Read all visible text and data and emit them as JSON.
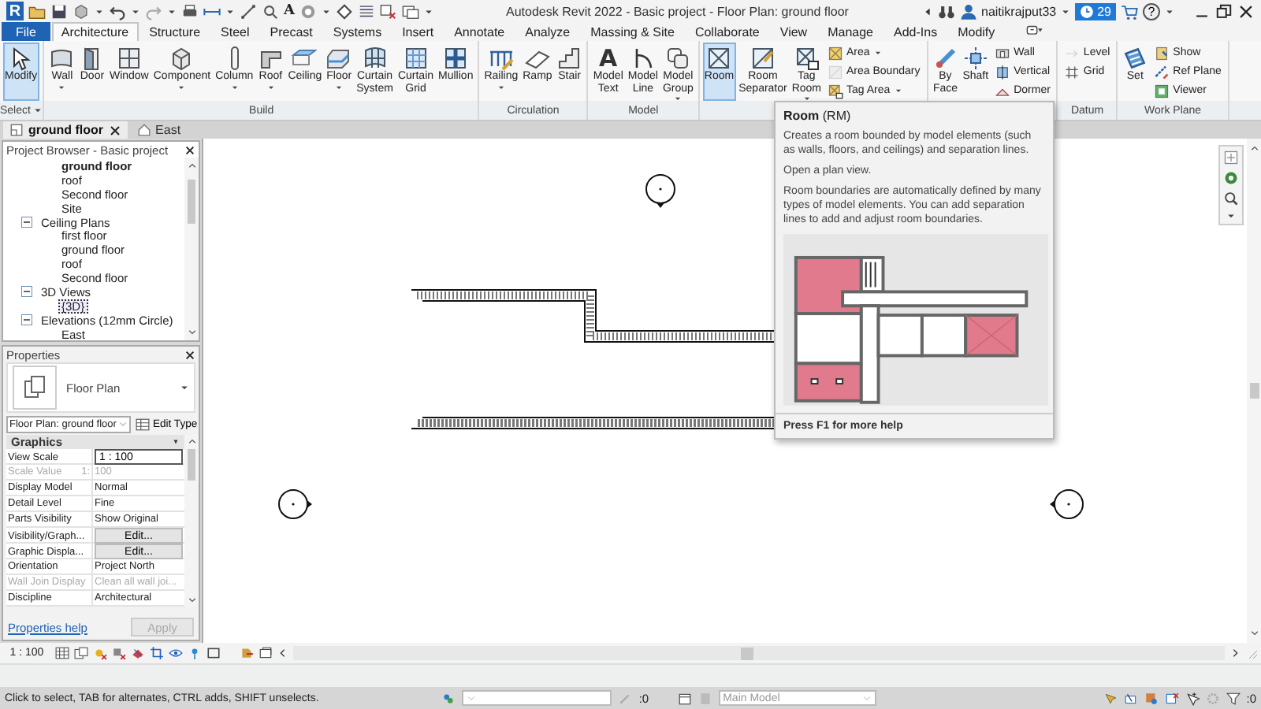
{
  "window": {
    "logo": "R",
    "text_tool": "A",
    "title": "Autodesk Revit 2022 - Basic project - Floor Plan: ground floor",
    "user": "naitikrajput33",
    "notifications": "29",
    "help": "?"
  },
  "ribbon_tabs": [
    {
      "label": "File",
      "kind": "application",
      "selected": false
    },
    {
      "label": "Architecture",
      "kind": "tab",
      "selected": true
    },
    {
      "label": "Structure",
      "kind": "tab",
      "selected": false
    },
    {
      "label": "Steel",
      "kind": "tab",
      "selected": false
    },
    {
      "label": "Precast",
      "kind": "tab",
      "selected": false
    },
    {
      "label": "Systems",
      "kind": "tab",
      "selected": false
    },
    {
      "label": "Insert",
      "kind": "tab",
      "selected": false
    },
    {
      "label": "Annotate",
      "kind": "tab",
      "selected": false
    },
    {
      "label": "Analyze",
      "kind": "tab",
      "selected": false
    },
    {
      "label": "Massing & Site",
      "kind": "tab",
      "selected": false
    },
    {
      "label": "Collaborate",
      "kind": "tab",
      "selected": false
    },
    {
      "label": "View",
      "kind": "tab",
      "selected": false
    },
    {
      "label": "Manage",
      "kind": "tab",
      "selected": false
    },
    {
      "label": "Add-Ins",
      "kind": "tab",
      "selected": false
    },
    {
      "label": "Modify",
      "kind": "tab",
      "selected": false
    }
  ],
  "ribbon_panels": [
    {
      "title": "Select",
      "title_dropdown": true,
      "tools": [
        {
          "label": "Modify",
          "kind": "large",
          "selected": true,
          "disabled": false,
          "dropdown": false
        }
      ]
    },
    {
      "title": "Build",
      "tools": [
        {
          "label": "Wall",
          "kind": "large",
          "selected": false,
          "disabled": false,
          "dropdown": true
        },
        {
          "label": "Door",
          "kind": "large",
          "selected": false,
          "disabled": false,
          "dropdown": false
        },
        {
          "label": "Window",
          "kind": "large",
          "selected": false,
          "disabled": false,
          "dropdown": false
        },
        {
          "label": "Component",
          "kind": "large",
          "selected": false,
          "disabled": false,
          "dropdown": true
        },
        {
          "label": "Column",
          "kind": "large",
          "selected": false,
          "disabled": false,
          "dropdown": true
        },
        {
          "label": "Roof",
          "kind": "large",
          "selected": false,
          "disabled": false,
          "dropdown": true
        },
        {
          "label": "Ceiling",
          "kind": "large",
          "selected": false,
          "disabled": false,
          "dropdown": false
        },
        {
          "label": "Floor",
          "kind": "large",
          "selected": false,
          "disabled": false,
          "dropdown": true
        },
        {
          "label": "Curtain System",
          "kind": "large",
          "selected": false,
          "disabled": false,
          "dropdown": false
        },
        {
          "label": "Curtain Grid",
          "kind": "large",
          "selected": false,
          "disabled": false,
          "dropdown": false
        },
        {
          "label": "Mullion",
          "kind": "large",
          "selected": false,
          "disabled": false,
          "dropdown": false
        }
      ]
    },
    {
      "title": "Circulation",
      "tools": [
        {
          "label": "Railing",
          "kind": "large",
          "selected": false,
          "disabled": false,
          "dropdown": true
        },
        {
          "label": "Ramp",
          "kind": "large",
          "selected": false,
          "disabled": false,
          "dropdown": false
        },
        {
          "label": "Stair",
          "kind": "large",
          "selected": false,
          "disabled": false,
          "dropdown": false
        }
      ]
    },
    {
      "title": "Model",
      "tools": [
        {
          "label": "Model Text",
          "kind": "large",
          "glyph": "A",
          "selected": false,
          "disabled": false,
          "dropdown": false
        },
        {
          "label": "Model Line",
          "kind": "large",
          "selected": false,
          "disabled": false,
          "dropdown": false
        },
        {
          "label": "Model Group",
          "kind": "large",
          "selected": false,
          "disabled": false,
          "dropdown": true
        }
      ]
    },
    {
      "tools": [
        {
          "label": "Room",
          "kind": "large",
          "selected": true,
          "disabled": false,
          "dropdown": false
        },
        {
          "label": "Room Separator",
          "kind": "large",
          "selected": false,
          "disabled": false,
          "dropdown": false
        },
        {
          "label": "Tag Room",
          "kind": "large",
          "selected": false,
          "disabled": false,
          "dropdown": true
        },
        {
          "label": "Area",
          "kind": "small",
          "selected": false,
          "disabled": false,
          "dropdown": true
        },
        {
          "label": "Area Boundary",
          "kind": "small",
          "selected": false,
          "disabled": true,
          "dropdown": false
        },
        {
          "label": "Tag Area",
          "kind": "small",
          "selected": false,
          "disabled": false,
          "dropdown": true
        }
      ]
    },
    {
      "tools": [
        {
          "label": "By Face",
          "kind": "large",
          "selected": false,
          "disabled": false,
          "dropdown": false
        },
        {
          "label": "Shaft",
          "kind": "large",
          "selected": false,
          "disabled": false,
          "dropdown": false
        },
        {
          "label": "Wall",
          "kind": "small",
          "selected": false,
          "disabled": false,
          "dropdown": false
        },
        {
          "label": "Vertical",
          "kind": "small",
          "selected": false,
          "disabled": false,
          "dropdown": false
        },
        {
          "label": "Dormer",
          "kind": "small",
          "selected": false,
          "disabled": false,
          "dropdown": false
        }
      ]
    },
    {
      "title": "Datum",
      "tools": [
        {
          "label": "Level",
          "kind": "small",
          "selected": false,
          "disabled": true,
          "dropdown": false
        },
        {
          "label": "Grid",
          "kind": "small",
          "selected": false,
          "disabled": false,
          "dropdown": false
        }
      ]
    },
    {
      "title": "Work Plane",
      "tools": [
        {
          "label": "Set",
          "kind": "large",
          "selected": false,
          "disabled": false,
          "dropdown": false
        },
        {
          "label": "Show",
          "kind": "small",
          "selected": false,
          "disabled": false,
          "dropdown": false
        },
        {
          "label": "Ref Plane",
          "kind": "small",
          "selected": false,
          "disabled": false,
          "dropdown": false
        },
        {
          "label": "Viewer",
          "kind": "small",
          "selected": false,
          "disabled": false,
          "dropdown": false
        }
      ]
    }
  ],
  "view_tabs": [
    {
      "label": "ground floor",
      "kind": "plan",
      "selected": true,
      "closable": true
    },
    {
      "label": "East",
      "kind": "elevation",
      "selected": false,
      "closable": false
    }
  ],
  "project_browser": {
    "title": "Project Browser - Basic project",
    "items": [
      {
        "children": [
          {
            "children": [
              {
                "label": "ground floor",
                "active": true,
                "selected": false
              },
              {
                "label": "roof",
                "active": false,
                "selected": false
              },
              {
                "label": "Second floor",
                "active": false,
                "selected": false
              },
              {
                "label": "Site",
                "active": false,
                "selected": false
              }
            ]
          },
          {
            "label": "Ceiling Plans",
            "expanded": true,
            "children": [
              {
                "label": "first floor",
                "active": false,
                "selected": false
              },
              {
                "label": "ground floor",
                "active": false,
                "selected": false
              },
              {
                "label": "roof",
                "active": false,
                "selected": false
              },
              {
                "label": "Second floor",
                "active": false,
                "selected": false
              }
            ]
          },
          {
            "label": "3D Views",
            "expanded": true,
            "children": [
              {
                "label": "{3D}",
                "active": false,
                "selected": true
              }
            ]
          },
          {
            "label": "Elevations (12mm Circle)",
            "expanded": true,
            "children": [
              {
                "label": "East",
                "active": false,
                "selected": false
              }
            ]
          }
        ]
      }
    ]
  },
  "properties": {
    "title": "Properties",
    "type_name": "Floor Plan",
    "instance": "Floor Plan: ground floor",
    "edit_type": "Edit Type",
    "group": "Graphics",
    "rows": [
      {
        "label": "View Scale",
        "value": "1 : 100",
        "kind": "input",
        "disabled": false
      },
      {
        "label": "Scale Value",
        "suffix": "1:",
        "value": "100",
        "kind": "text",
        "disabled": true
      },
      {
        "label": "Display Model",
        "value": "Normal",
        "kind": "text",
        "disabled": false
      },
      {
        "label": "Detail Level",
        "value": "Fine",
        "kind": "text",
        "disabled": false
      },
      {
        "label": "Parts Visibility",
        "value": "Show Original",
        "kind": "text",
        "disabled": false
      },
      {
        "label": "Visibility/Graph...",
        "value": "Edit...",
        "kind": "button",
        "disabled": false
      },
      {
        "label": "Graphic Displa...",
        "value": "Edit...",
        "kind": "button",
        "disabled": false
      },
      {
        "label": "Orientation",
        "value": "Project North",
        "kind": "text",
        "disabled": false
      },
      {
        "label": "Wall Join Display",
        "value": "Clean all wall joi...",
        "kind": "text",
        "disabled": true
      },
      {
        "label": "Discipline",
        "value": "Architectural",
        "kind": "text",
        "disabled": false
      }
    ],
    "help_link": "Properties help",
    "apply": "Apply",
    "apply_disabled": true
  },
  "tooltip": {
    "title": "**Room** (RM)",
    "paragraphs": [
      "Creates a room bounded by model elements (such as walls, floors, and ceilings) and separation lines.",
      "Open a plan view.",
      "Room boundaries are automatically defined by many types of model elements. You can add separation lines to add and adjust room boundaries."
    ],
    "footer": "Press F1 for more help"
  },
  "view_bar": {
    "scale": "1 : 100"
  },
  "status_bar": {
    "message": "Click to select, TAB for alternates, CTRL adds, SHIFT unselects.",
    "editable_count": ":0",
    "model": "Main Model",
    "filter_count": ":0"
  }
}
